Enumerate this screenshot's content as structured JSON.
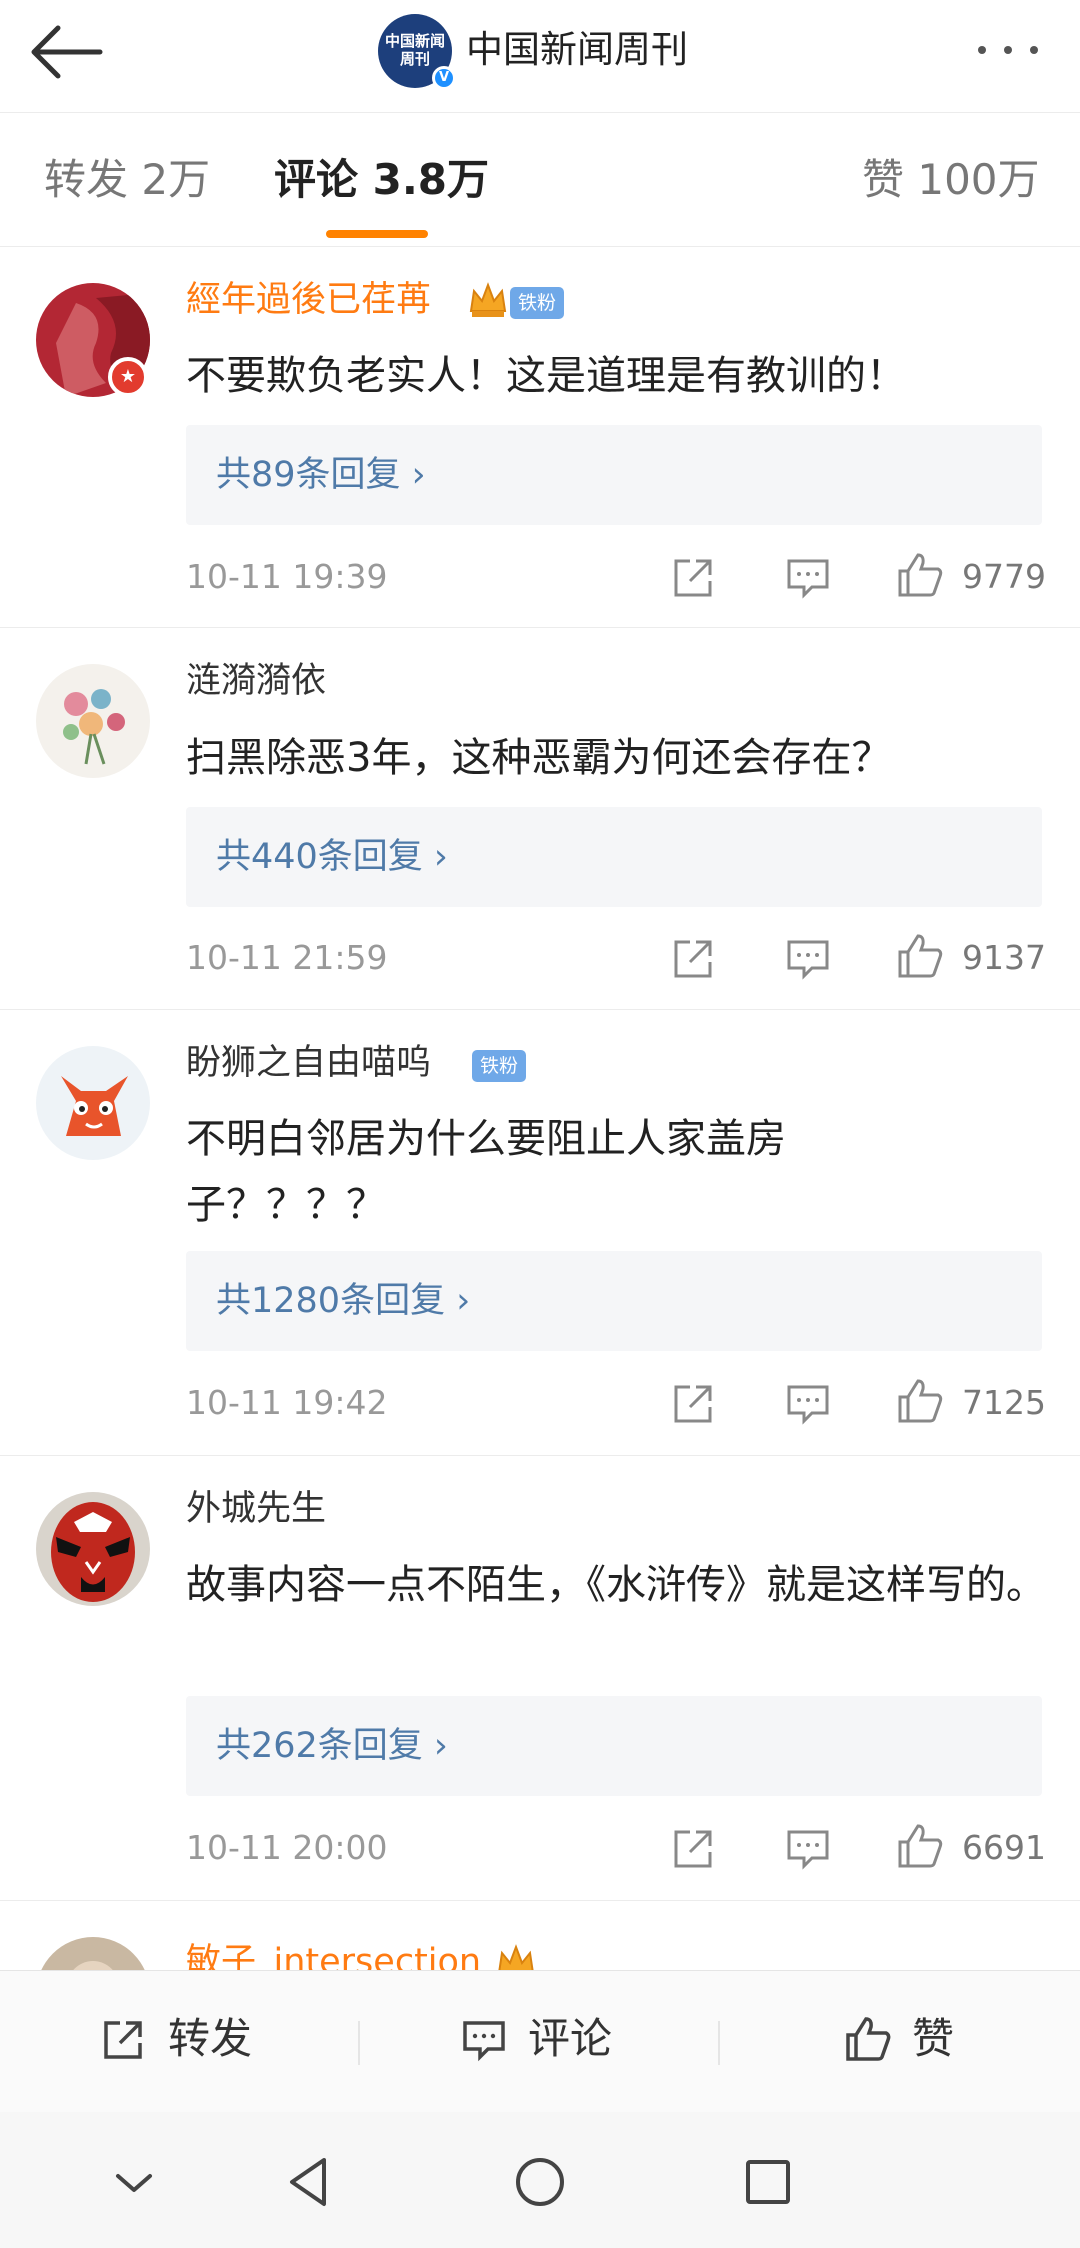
{
  "header": {
    "account_name": "中国新闻周刊",
    "logo_text": "中国新闻周刊",
    "verified_mark": "V"
  },
  "tabs": [
    {
      "label": "转发 2万"
    },
    {
      "label": "评论 3.8万"
    },
    {
      "label": "赞 100万"
    }
  ],
  "comments": [
    {
      "username": "經年過後已荏苒",
      "badge": "铁粉",
      "text": "不要欺负老实人！这是道理是有教训的！",
      "replies": "共89条回复 ›",
      "time": "10-11 19:39",
      "likes": "9779"
    },
    {
      "username": "涟漪漪依",
      "badge": "",
      "text": "扫黑除恶3年，这种恶霸为何还会存在？",
      "replies": "共440条回复 ›",
      "time": "10-11 21:59",
      "likes": "9137"
    },
    {
      "username": "盼狮之自由喵呜",
      "badge": "铁粉",
      "text": "不明白邻居为什么要阻止人家盖房\n子？？？？",
      "replies": "共1280条回复 ›",
      "time": "10-11 19:42",
      "likes": "7125"
    },
    {
      "username": "外城先生",
      "badge": "",
      "text": "故事内容一点不陌生，《水浒传》就是这样写的。",
      "replies": "共262条回复 ›",
      "time": "10-11 20:00",
      "likes": "6691"
    },
    {
      "username": "敏子_intersection",
      "badge": "",
      "text": "",
      "replies": "",
      "time": "",
      "likes": ""
    }
  ],
  "bottom_bar": {
    "repost": "转发",
    "comment": "评论",
    "like": "赞"
  },
  "colors": {
    "accent": "#ff8200",
    "vip_name": "#ff7b12",
    "link": "#4f7aa8",
    "fan_badge": "#6fa8e8"
  },
  "icons": [
    "back-arrow-icon",
    "more-icon",
    "crown-icon",
    "share-icon",
    "comment-icon",
    "like-icon",
    "nav-back-icon",
    "nav-home-icon",
    "nav-recent-icon",
    "nav-collapse-icon"
  ]
}
